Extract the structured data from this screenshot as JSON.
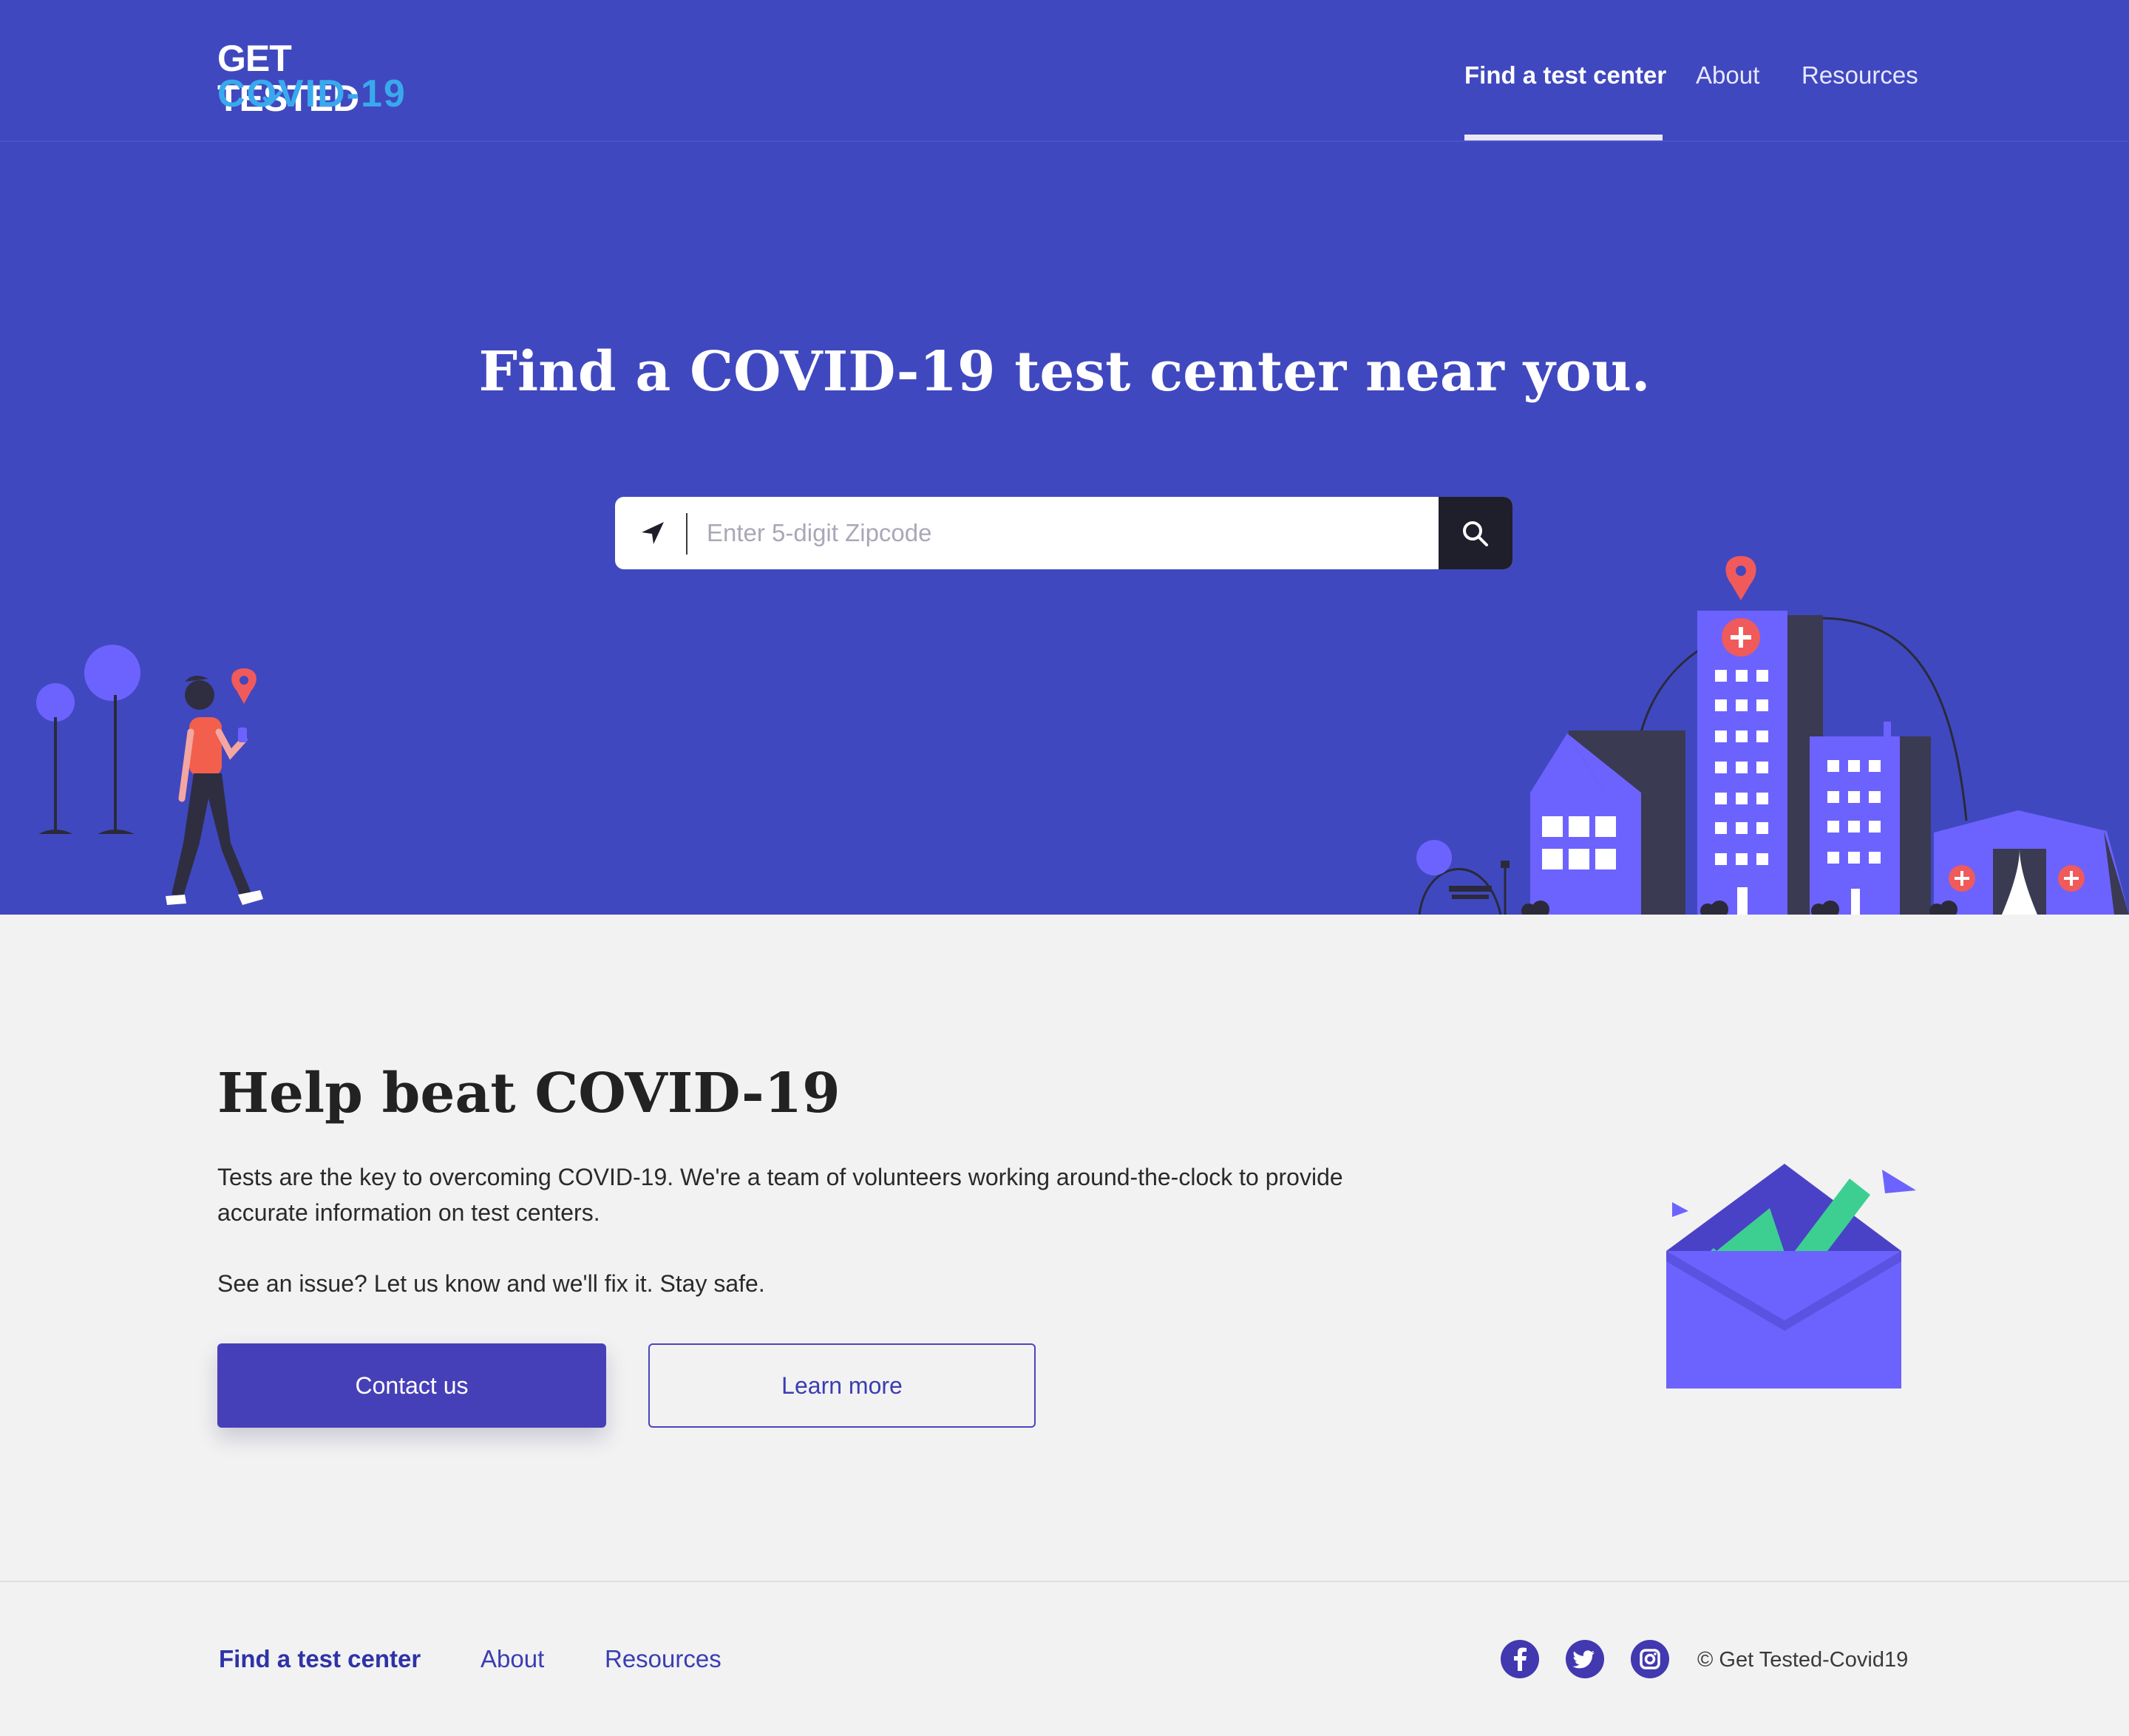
{
  "header": {
    "logo_line1": "GET TESTED",
    "logo_line2": "COVID-19",
    "nav": [
      {
        "label": "Find a test center",
        "active": true
      },
      {
        "label": "About",
        "active": false
      },
      {
        "label": "Resources",
        "active": false
      }
    ]
  },
  "hero": {
    "title": "Find a COVID-19 test center near you.",
    "search": {
      "placeholder": "Enter 5-digit Zipcode",
      "value": "",
      "location_icon": "location-arrow-icon",
      "submit_icon": "search-icon"
    }
  },
  "help": {
    "title": "Help beat COVID-19",
    "paragraph1": "Tests are the key to overcoming COVID-19. We're a team of volunteers working around-the-clock to provide accurate information on test centers.",
    "paragraph2": "See an issue? Let us know and we'll fix it. Stay safe.",
    "primary_button": "Contact us",
    "secondary_button": "Learn more"
  },
  "footer": {
    "nav": [
      {
        "label": "Find a test center",
        "active": true
      },
      {
        "label": "About",
        "active": false
      },
      {
        "label": "Resources",
        "active": false
      }
    ],
    "social": [
      "facebook-icon",
      "twitter-icon",
      "instagram-icon"
    ],
    "copyright": "© Get Tested-Covid19"
  },
  "colors": {
    "hero_bg": "#4048bf",
    "page_bg": "#f2f2f2",
    "accent": "#4640b8",
    "logo_blue": "#39a9ee",
    "illustration_purple": "#6c63ff",
    "pin_red": "#f05a5a",
    "check_green": "#3ccf91"
  }
}
